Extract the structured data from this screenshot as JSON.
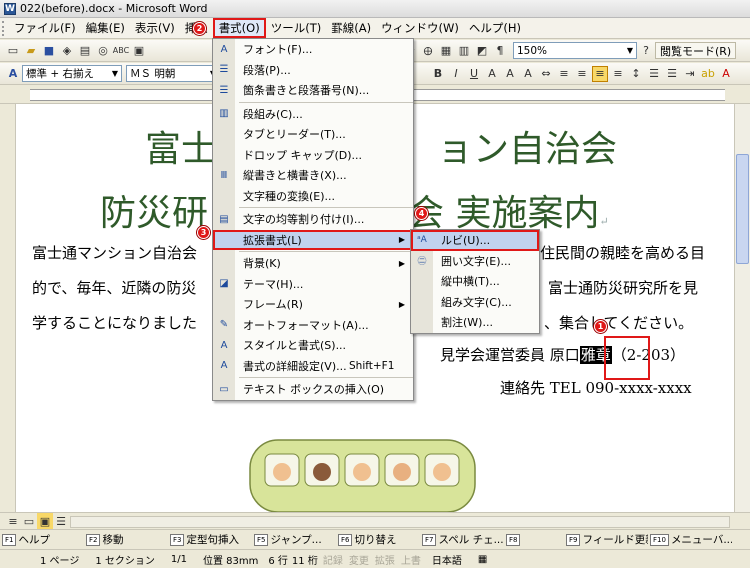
{
  "window": {
    "title": "022(before).docx - Microsoft Word"
  },
  "menubar": {
    "items": [
      "ファイル(F)",
      "編集(E)",
      "表示(V)",
      "挿入",
      "書式(O)",
      "ツール(T)",
      "罫線(A)",
      "ウィンドウ(W)",
      "ヘルプ(H)"
    ]
  },
  "toolbar": {
    "zoom": "150%",
    "reading_mode": "閲覧モード(R)"
  },
  "formatting": {
    "style": "標準 + 右揃え",
    "font": "ＭＳ 明朝"
  },
  "format_menu": {
    "items": [
      "フォント(F)...",
      "段落(P)...",
      "箇条書きと段落番号(N)...",
      "段組み(C)...",
      "タブとリーダー(T)...",
      "ドロップ キャップ(D)...",
      "縦書きと横書き(X)...",
      "文字種の変換(E)...",
      "文字の均等割り付け(I)...",
      "拡張書式(L)",
      "背景(K)",
      "テーマ(H)...",
      "フレーム(R)",
      "オートフォーマット(A)...",
      "スタイルと書式(S)...",
      "書式の詳細設定(V)...",
      "テキスト ボックスの挿入(O)"
    ],
    "shortcut": "Shift+F1"
  },
  "submenu": {
    "items": [
      "ルビ(U)...",
      "囲い文字(E)...",
      "縦中横(T)...",
      "組み文字(C)...",
      "割注(W)..."
    ]
  },
  "document": {
    "heading1_left": "富士",
    "heading1_right": "ョン自治会",
    "heading2_left": "防災研",
    "heading2_right": "会  実施案内",
    "line1_left": "富士通マンション自治会",
    "line1_right": "住民間の親睦を高める目",
    "line2_left": "的で、毎年、近隣の防災",
    "line2_right": "富士通防災研究所を見",
    "line3_left": "学することになりました",
    "line3_right": "、集合してください。",
    "committee": "見学会運営委員  原口",
    "selected_text": "雅章",
    "committee_tail": "（2-203）",
    "contact": "連絡先  TEL 090-xxxx-xxxx"
  },
  "badges": [
    "1",
    "2",
    "3",
    "4"
  ],
  "fkeys": [
    {
      "num": "F1",
      "label": "ヘルプ"
    },
    {
      "num": "F2",
      "label": "移動"
    },
    {
      "num": "F3",
      "label": "定型句挿入"
    },
    {
      "num": "F5",
      "label": "ジャンプ..."
    },
    {
      "num": "F6",
      "label": "切り替え"
    },
    {
      "num": "F7",
      "label": "スペル チェ..."
    },
    {
      "num": "F8",
      "label": ""
    },
    {
      "num": "F9",
      "label": "フィールド更新"
    },
    {
      "num": "F10",
      "label": "メニューバ..."
    }
  ],
  "status": {
    "page": "1 ページ",
    "section": "1 セクション",
    "pages": "1/1",
    "position": "位置 83mm",
    "line": "6 行",
    "col": "11 桁",
    "rec": "記録",
    "trk": "変更",
    "ext": "拡張",
    "ovr": "上書",
    "lang": "日本語"
  },
  "colors": {
    "accent_red": "#e01818",
    "heading_green": "#2f5a2a",
    "menu_highlight": "#c1d2ee"
  }
}
